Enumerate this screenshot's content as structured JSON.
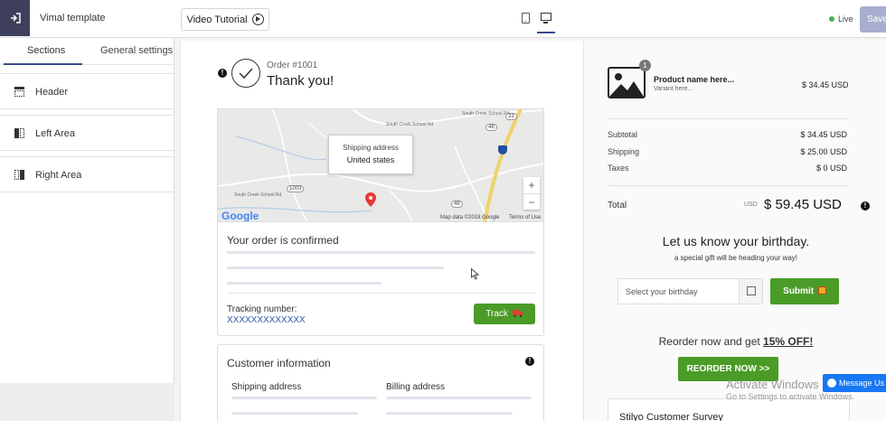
{
  "header": {
    "template_name": "Vimal template",
    "video_tutorial_label": "Video Tutorial",
    "live_label": "Live",
    "save_label": "Save"
  },
  "sidebar": {
    "tabs": [
      {
        "label": "Sections",
        "active": true
      },
      {
        "label": "General settings",
        "active": false
      }
    ],
    "items": [
      {
        "label": "Header",
        "icon": "header-layout-icon"
      },
      {
        "label": "Left Area",
        "icon": "left-area-layout-icon"
      },
      {
        "label": "Right Area",
        "icon": "right-area-layout-icon"
      }
    ]
  },
  "order": {
    "number": "Order #1001",
    "thanks": "Thank you!"
  },
  "map": {
    "tooltip_title": "Shipping address",
    "tooltip_value": "United states",
    "zoom_in": "+",
    "zoom_out": "−",
    "logo": "Google",
    "attribution": "Map data ©2018 Google",
    "terms": "Terms of Use",
    "road_labels": [
      "South Creek School Rd",
      "South Creek School Rd",
      "South Creek School Rd"
    ],
    "shields": [
      "33",
      "48",
      "1003",
      "48"
    ]
  },
  "confirmation": {
    "title": "Your order is confirmed",
    "tracking_label": "Tracking number:",
    "tracking_number": "XXXXXXXXXXXXX",
    "track_button": "Track"
  },
  "customer": {
    "title": "Customer information",
    "shipping_header": "Shipping address",
    "billing_header": "Billing address"
  },
  "summary": {
    "product_name": "Product name here...",
    "variant": "Variant here...",
    "quantity_badge": "1",
    "product_price": "$ 34.45 USD",
    "rows": [
      {
        "label": "Subtotal",
        "value": "$ 34.45 USD"
      },
      {
        "label": "Shipping",
        "value": "$ 25.00 USD"
      },
      {
        "label": "Taxes",
        "value": "$ 0 USD"
      }
    ],
    "total_label": "Total",
    "total_currency": "USD",
    "total_value": "$ 59.45 USD"
  },
  "birthday": {
    "title": "Let us know your birthday.",
    "subtitle": "a special gift will be heading your way!",
    "placeholder": "Select your birthday",
    "submit_label": "Submit"
  },
  "reorder": {
    "prefix": "Reorder now and get ",
    "highlight": "15% OFF!",
    "button": "REORDER NOW >>"
  },
  "survey": {
    "title": "Stilyo Customer Survey"
  },
  "overlay": {
    "watermark_title": "Activate Windows",
    "watermark_sub": "Go to Settings to activate Windows.",
    "messenger_label": "Message Us"
  },
  "colors": {
    "accent_navy": "#3b4a8c",
    "button_green": "#4a9b27",
    "save_button": "#a9aece",
    "messenger_blue": "#1877f2"
  }
}
